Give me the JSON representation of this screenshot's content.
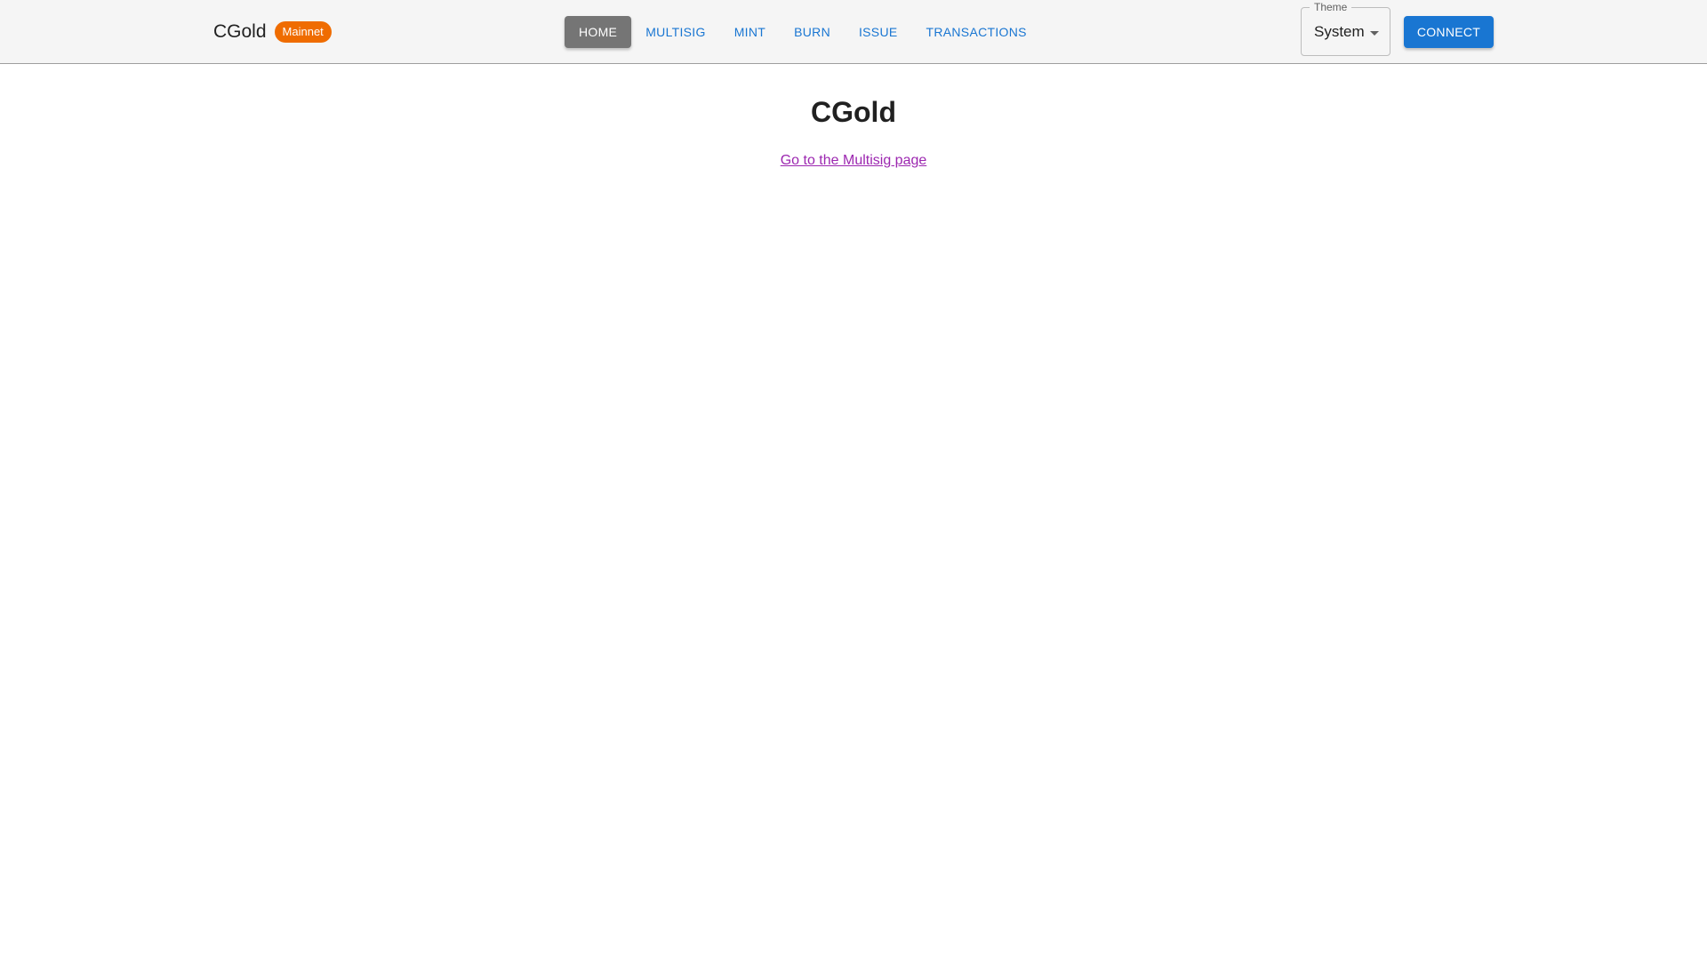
{
  "header": {
    "brand_title": "CGold",
    "network_badge": "Mainnet",
    "nav": [
      {
        "label": "HOME",
        "active": true
      },
      {
        "label": "MULTISIG",
        "active": false
      },
      {
        "label": "MINT",
        "active": false
      },
      {
        "label": "BURN",
        "active": false
      },
      {
        "label": "ISSUE",
        "active": false
      },
      {
        "label": "TRANSACTIONS",
        "active": false
      }
    ],
    "theme": {
      "label": "Theme",
      "value": "System"
    },
    "connect_label": "CONNECT"
  },
  "main": {
    "title": "CGold",
    "multisig_link": "Go to the Multisig page"
  },
  "colors": {
    "primary": "#1976d2",
    "badge": "#ef6c00",
    "active_nav": "#757575",
    "link_visited": "#9c27b0"
  }
}
